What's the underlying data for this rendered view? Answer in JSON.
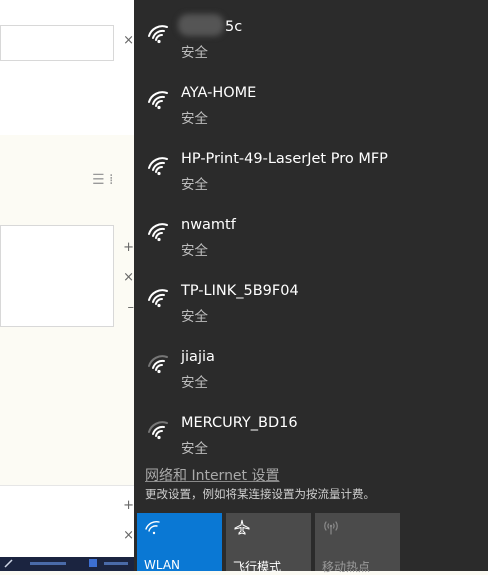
{
  "networks": [
    {
      "name": "5c",
      "security": "安全"
    },
    {
      "name": "AYA-HOME",
      "security": "安全"
    },
    {
      "name": "HP-Print-49-LaserJet Pro MFP",
      "security": "安全"
    },
    {
      "name": "nwamtf",
      "security": "安全"
    },
    {
      "name": "TP-LINK_5B9F04",
      "security": "安全"
    },
    {
      "name": "jiajia",
      "security": "安全"
    },
    {
      "name": "MERCURY_BD16",
      "security": "安全"
    }
  ],
  "settings": {
    "link": "网络和 Internet 设置",
    "description": "更改设置，例如将某连接设置为按流量计费。"
  },
  "tiles": [
    {
      "label": "WLAN",
      "icon": "wifi-icon",
      "state": "on"
    },
    {
      "label": "飞行模式",
      "icon": "airplane-icon",
      "state": "off"
    },
    {
      "label": "移动热点",
      "icon": "hotspot-icon",
      "state": "disabled"
    }
  ],
  "colors": {
    "flyout_bg": "#2b2b2b",
    "accent": "#0a78d4",
    "tile_bg": "#4b4b4b"
  }
}
